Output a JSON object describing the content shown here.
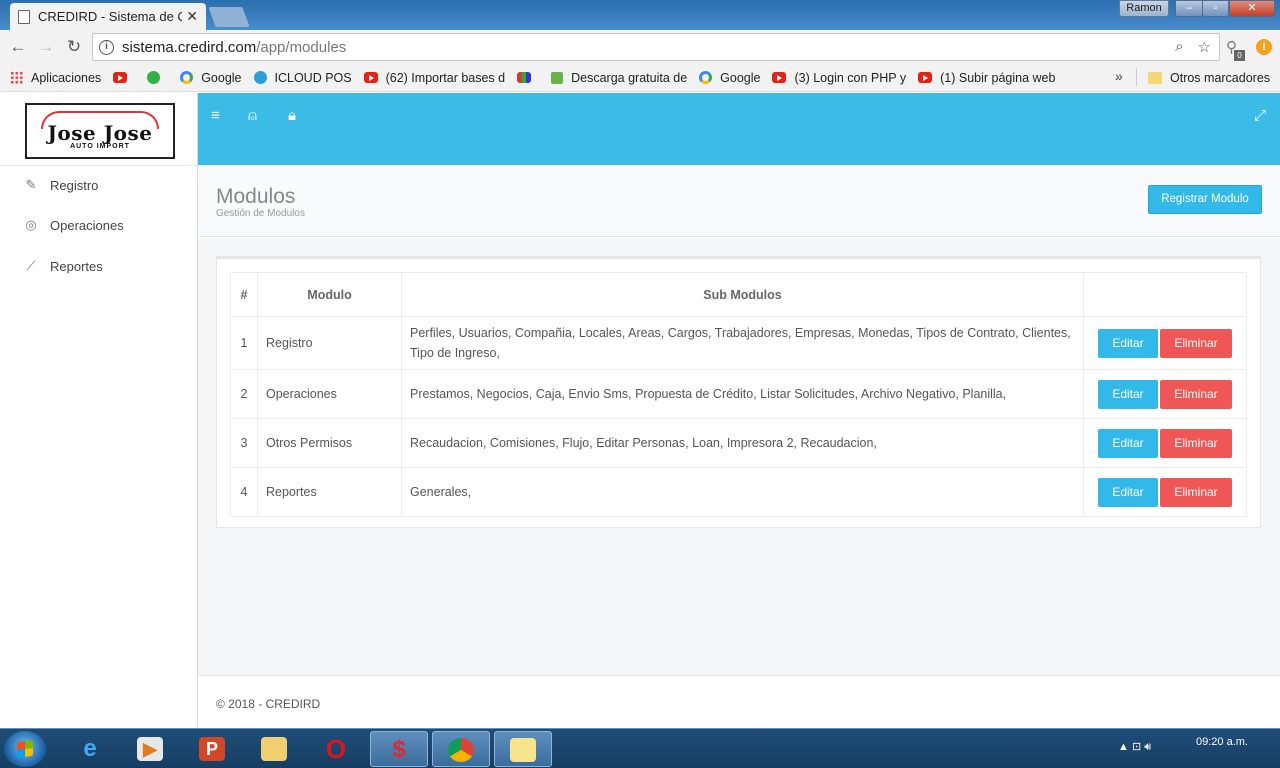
{
  "browser": {
    "tab_title": "CREDIRD - Sistema de Co",
    "window_user": "Ramon",
    "url_host": "sistema.credird.com",
    "url_path": "/app/modules",
    "extension_badge": "0",
    "bookmarks": [
      {
        "label": "Aplicaciones",
        "icon": "apps-icon"
      },
      {
        "label": "",
        "icon": "youtube-icon"
      },
      {
        "label": "",
        "icon": "whatsapp-icon"
      },
      {
        "label": "Google",
        "icon": "google-icon"
      },
      {
        "label": "ICLOUD POS",
        "icon": "bolt-icon"
      },
      {
        "label": "(62) Importar bases d",
        "icon": "youtube-icon"
      },
      {
        "label": "",
        "icon": "multicolor-icon"
      },
      {
        "label": "Descarga gratuita de",
        "icon": "download-icon"
      },
      {
        "label": "Google",
        "icon": "google-icon"
      },
      {
        "label": "(3) Login con PHP y",
        "icon": "youtube-icon"
      },
      {
        "label": "(1) Subir página web",
        "icon": "youtube-icon"
      }
    ],
    "other_bookmarks": "Otros marcadores"
  },
  "logo": {
    "title": "Jose Jose",
    "subtitle": "AUTO IMPORT"
  },
  "sidebar": {
    "items": [
      {
        "label": "Registro",
        "icon": "edit-icon"
      },
      {
        "label": "Operaciones",
        "icon": "globe-icon"
      },
      {
        "label": "Reportes",
        "icon": "chart-line-icon"
      }
    ]
  },
  "page": {
    "title": "Modulos",
    "subtitle": "Gestión de Modulos",
    "register_button": "Registrar Modulo"
  },
  "table": {
    "headers": {
      "num": "#",
      "module": "Modulo",
      "submodules": "Sub Modulos",
      "actions": ""
    },
    "edit_label": "Editar",
    "delete_label": "Eliminar",
    "rows": [
      {
        "num": "1",
        "module": "Registro",
        "submodules": "Perfiles, Usuarios, Compañia, Locales, Areas, Cargos, Trabajadores, Empresas, Monedas, Tipos de Contrato, Clientes, Tipo de Ingreso,"
      },
      {
        "num": "2",
        "module": "Operaciones",
        "submodules": "Prestamos, Negocios, Caja, Envio Sms, Propuesta de Crédito, Listar Solicitudes, Archivo Negativo, Planilla,"
      },
      {
        "num": "3",
        "module": "Otros Permisos",
        "submodules": "Recaudacion, Comisiones, Flujo, Editar Personas, Loan, Impresora 2, Recaudacion,"
      },
      {
        "num": "4",
        "module": "Reportes",
        "submodules": "Generales,"
      }
    ]
  },
  "footer": {
    "text": "© 2018 - CREDIRD"
  },
  "taskbar": {
    "time": "09:20 a.m.",
    "apps": [
      "internet-explorer-icon",
      "media-player-icon",
      "powerpoint-icon",
      "file-explorer-icon",
      "opera-icon",
      "dollar-app-icon",
      "chrome-icon",
      "sticky-notes-icon"
    ]
  },
  "colors": {
    "accent": "#3bbce6",
    "danger": "#ef5656",
    "button_primary": "#32b9e7"
  }
}
